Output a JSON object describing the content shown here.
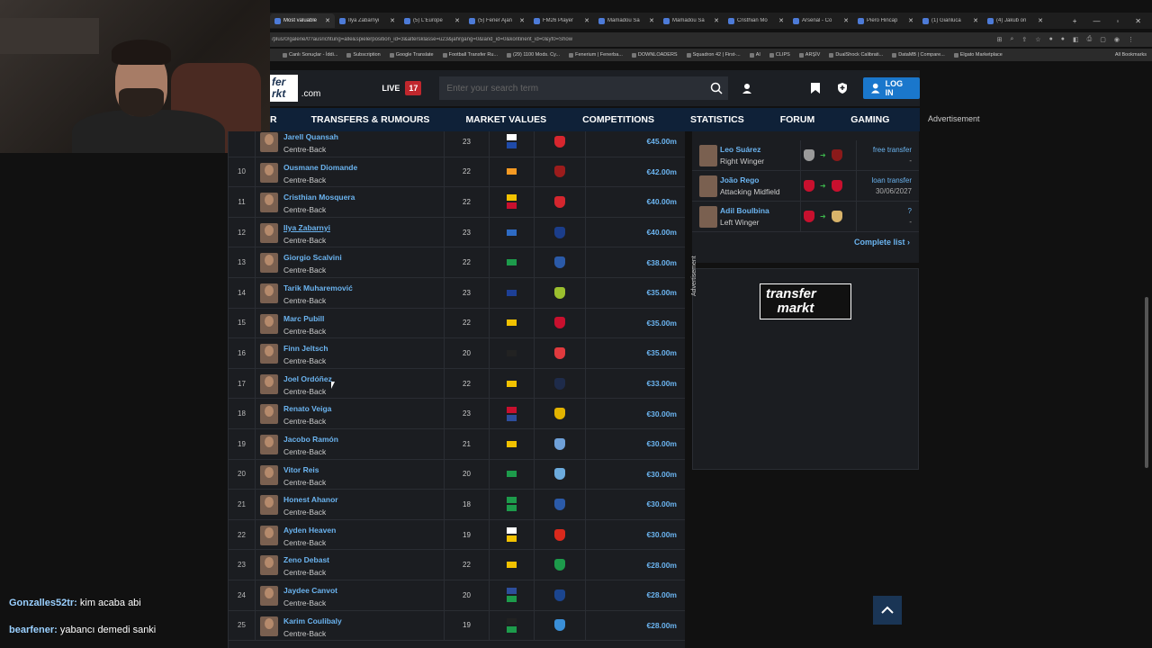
{
  "browser": {
    "tabs": [
      {
        "title": "Most valuable",
        "active": true
      },
      {
        "title": "Ilya Zabarnyi"
      },
      {
        "title": "(5) L'Europe"
      },
      {
        "title": "(5) Fener Ajan"
      },
      {
        "title": "FM26 Player"
      },
      {
        "title": "Mamadou Sa"
      },
      {
        "title": "Mamadou Sa"
      },
      {
        "title": "Cristhian Mo"
      },
      {
        "title": "Arsenal - Co"
      },
      {
        "title": "Piero Hincap"
      },
      {
        "title": "(1) Gianluca"
      },
      {
        "title": "(4) Jakub on"
      }
    ],
    "url": "/plus/0/galerie/0?ausrichtung=alle&spielerposition_id=3&altersklasse=u23&jahrgang=0&land_id=0&kontinent_id=0&yt0=Show",
    "bookmarks": [
      "Canlı Sonuçlar - İddi...",
      "Subscription",
      "Google Translate",
      "Football Transfer Ru...",
      "(29) 1100 Mods. Cy...",
      "Fenerium | Fenerba...",
      "DOWNLOADERS",
      "Squadron 42 | First-...",
      "AI",
      "CLIPS",
      "ARŞİV",
      "DualShock Calibrati...",
      "DataMB | Compare...",
      "Elgato Marketplace"
    ],
    "all_bookmarks": "All Bookmarks"
  },
  "site": {
    "logo_text": "fer\nrkt",
    "logo_suffix": ".com",
    "live_label": "LIVE",
    "live_count": "17",
    "search_placeholder": "Enter your search term",
    "login_label": "LOG IN",
    "nav": [
      "R",
      "TRANSFERS & RUMOURS",
      "MARKET VALUES",
      "COMPETITIONS",
      "STATISTICS",
      "FORUM",
      "GAMING"
    ],
    "advertisement": "Advertisement"
  },
  "players": [
    {
      "rank": "",
      "name": "Jarell Quansah",
      "pos": "Centre-Back",
      "age": "23",
      "flags": [
        "#ffffff",
        "#1f4aa8"
      ],
      "crest": "#d7262e",
      "value": "€45.00m"
    },
    {
      "rank": "10",
      "name": "Ousmane Diomande",
      "pos": "Centre-Back",
      "age": "22",
      "flags": [
        "#f59a23"
      ],
      "crest": "#9c1c1c",
      "value": "€42.00m"
    },
    {
      "rank": "11",
      "name": "Cristhian Mosquera",
      "pos": "Centre-Back",
      "age": "22",
      "flags": [
        "#f2c200",
        "#c8102e"
      ],
      "crest": "#d4262e",
      "value": "€40.00m"
    },
    {
      "rank": "12",
      "name": "Ilya Zabarnyi",
      "pos": "Centre-Back",
      "age": "23",
      "flags": [
        "#2e6bc4"
      ],
      "crest": "#1b3d8a",
      "value": "€40.00m"
    },
    {
      "rank": "13",
      "name": "Giorgio Scalvini",
      "pos": "Centre-Back",
      "age": "22",
      "flags": [
        "#1d9b4b"
      ],
      "crest": "#2b5aa8",
      "value": "€38.00m"
    },
    {
      "rank": "14",
      "name": "Tarik Muharemović",
      "pos": "Centre-Back",
      "age": "23",
      "flags": [
        "#1d3f95"
      ],
      "crest": "#9bbf2e",
      "value": "€35.00m"
    },
    {
      "rank": "15",
      "name": "Marc Pubill",
      "pos": "Centre-Back",
      "age": "22",
      "flags": [
        "#f2c200"
      ],
      "crest": "#c8102e",
      "value": "€35.00m"
    },
    {
      "rank": "16",
      "name": "Finn Jeltsch",
      "pos": "Centre-Back",
      "age": "20",
      "flags": [
        "#222222"
      ],
      "crest": "#e03a3e",
      "value": "€35.00m"
    },
    {
      "rank": "17",
      "name": "Joel Ordóñez",
      "pos": "Centre-Back",
      "age": "22",
      "flags": [
        "#f2c200"
      ],
      "crest": "#1e2b4a",
      "value": "€33.00m"
    },
    {
      "rank": "18",
      "name": "Renato Veiga",
      "pos": "Centre-Back",
      "age": "23",
      "flags": [
        "#c8102e",
        "#2d4e9c"
      ],
      "crest": "#e2b300",
      "value": "€30.00m"
    },
    {
      "rank": "19",
      "name": "Jacobo Ramón",
      "pos": "Centre-Back",
      "age": "21",
      "flags": [
        "#f2c200"
      ],
      "crest": "#6fa0d8",
      "value": "€30.00m"
    },
    {
      "rank": "20",
      "name": "Vitor Reis",
      "pos": "Centre-Back",
      "age": "20",
      "flags": [
        "#1d9b4b"
      ],
      "crest": "#6cabdd",
      "value": "€30.00m"
    },
    {
      "rank": "21",
      "name": "Honest Ahanor",
      "pos": "Centre-Back",
      "age": "18",
      "flags": [
        "#1d9b4b",
        "#1d9b4b"
      ],
      "crest": "#2b5aa8",
      "value": "€30.00m"
    },
    {
      "rank": "22",
      "name": "Ayden Heaven",
      "pos": "Centre-Back",
      "age": "19",
      "flags": [
        "#ffffff",
        "#f2c200"
      ],
      "crest": "#da291c",
      "value": "€30.00m"
    },
    {
      "rank": "23",
      "name": "Zeno Debast",
      "pos": "Centre-Back",
      "age": "22",
      "flags": [
        "#f2c200"
      ],
      "crest": "#1d9b4b",
      "value": "€28.00m"
    },
    {
      "rank": "24",
      "name": "Jaydee Canvot",
      "pos": "Centre-Back",
      "age": "20",
      "flags": [
        "#2d4e9c",
        "#1d9b4b"
      ],
      "crest": "#1b458f",
      "value": "€28.00m"
    },
    {
      "rank": "25",
      "name": "Karim Coulibaly",
      "pos": "Centre-Back",
      "age": "19",
      "flags": [
        "#222222",
        "#1d9b4b"
      ],
      "crest": "#3a8fd8",
      "value": "€28.00m"
    }
  ],
  "transfers": [
    {
      "name": "Leo Suárez",
      "pos": "Right Winger",
      "fee": "free transfer",
      "sub": "-"
    },
    {
      "name": "João Rego",
      "pos": "Attacking Midfield",
      "fee": "loan transfer",
      "sub": "30/06/2027"
    },
    {
      "name": "Adil Boulbina",
      "pos": "Left Winger",
      "fee": "?",
      "sub": "-"
    }
  ],
  "complete_list": "Complete list ›",
  "ad_vertical": "Advertisement",
  "tm_logo": "transfer\nmarkt",
  "chat": [
    {
      "user": "Gonzalles52tr:",
      "msg": "kim acaba abi"
    },
    {
      "user": "bearfener:",
      "msg": "yabancı demedi sanki"
    }
  ]
}
